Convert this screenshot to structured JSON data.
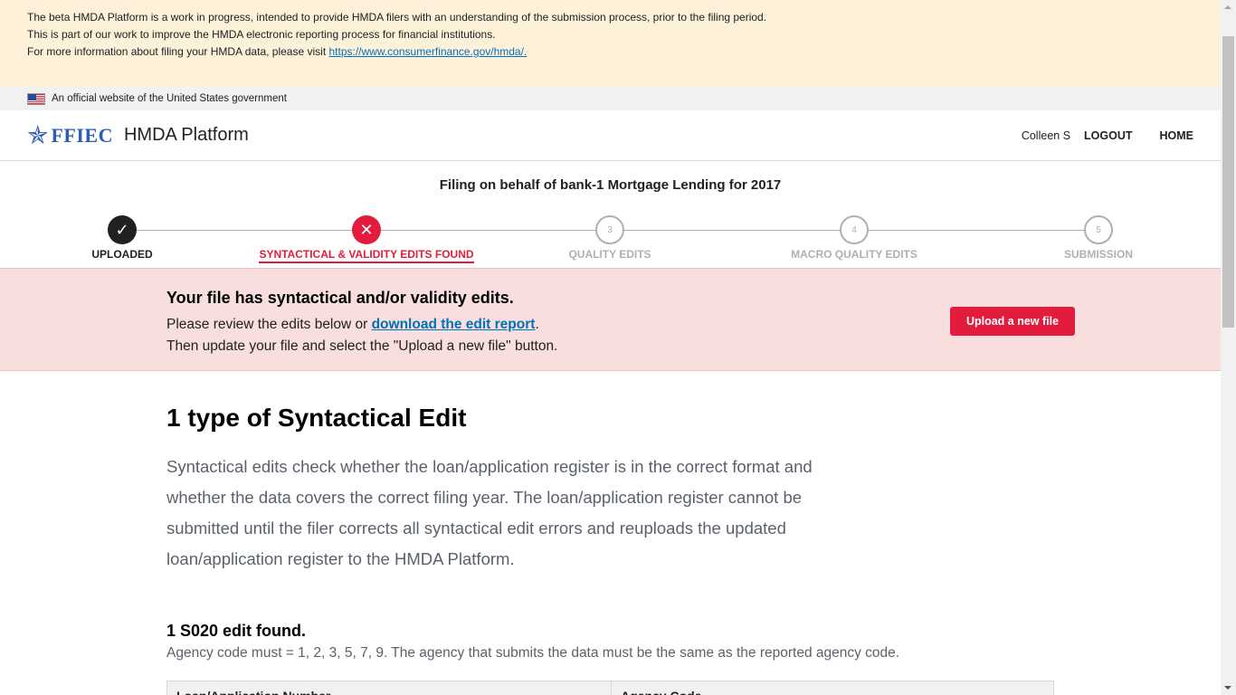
{
  "beta_banner": {
    "line1": "The beta HMDA Platform is a work in progress, intended to provide HMDA filers with an understanding of the submission process, prior to the filing period.",
    "line2": "This is part of our work to improve the HMDA electronic reporting process for financial institutions.",
    "line3_prefix": "For more information about filing your HMDA data, please visit ",
    "line3_link": "https://www.consumerfinance.gov/hmda/."
  },
  "gov_banner": {
    "text": "An official website of the United States government",
    "icon": "us-flag-icon"
  },
  "header": {
    "logo_text": "FFIEC",
    "logo_icon": "star-icon",
    "platform_title": "HMDA Platform",
    "user_name": "Colleen S",
    "logout_label": "LOGOUT",
    "home_label": "HOME"
  },
  "filing_title": "Filing on behalf of bank-1 Mortgage Lending for 2017",
  "progress": {
    "steps": [
      {
        "label": "UPLOADED",
        "marker": "✓",
        "state": "done"
      },
      {
        "label": "SYNTACTICAL & VALIDITY EDITS FOUND",
        "marker": "✕",
        "state": "error"
      },
      {
        "label": "QUALITY EDITS",
        "marker": "3",
        "state": "todo"
      },
      {
        "label": "MACRO QUALITY EDITS",
        "marker": "4",
        "state": "todo"
      },
      {
        "label": "SUBMISSION",
        "marker": "5",
        "state": "todo"
      }
    ]
  },
  "alert": {
    "heading": "Your file has syntactical and/or validity edits.",
    "body_prefix": "Please review the edits below or ",
    "body_link": "download the edit report",
    "body_suffix": ".",
    "body_line2": "Then update your file and select the \"Upload a new file\" button.",
    "button_label": "Upload a new file"
  },
  "main": {
    "heading": "1 type of Syntactical Edit",
    "description": "Syntactical edits check whether the loan/application register is in the correct format and whether the data covers the correct filing year. The loan/application register cannot be submitted until the filer corrects all syntactical edit errors and reuploads the updated loan/application register to the HMDA Platform.",
    "edit_title": "1 S020 edit found.",
    "edit_description": "Agency code must = 1, 2, 3, 5, 7, 9. The agency that submits the data must be the same as the reported agency code.",
    "table_headers": [
      "Loan/Application Number",
      "Agency Code"
    ]
  },
  "colors": {
    "error_red": "#e31c3d",
    "beta_bg": "#fdf1da",
    "alert_bg": "#f9dede",
    "link_blue": "#0071bc",
    "brand_blue": "#2b5eb3"
  }
}
